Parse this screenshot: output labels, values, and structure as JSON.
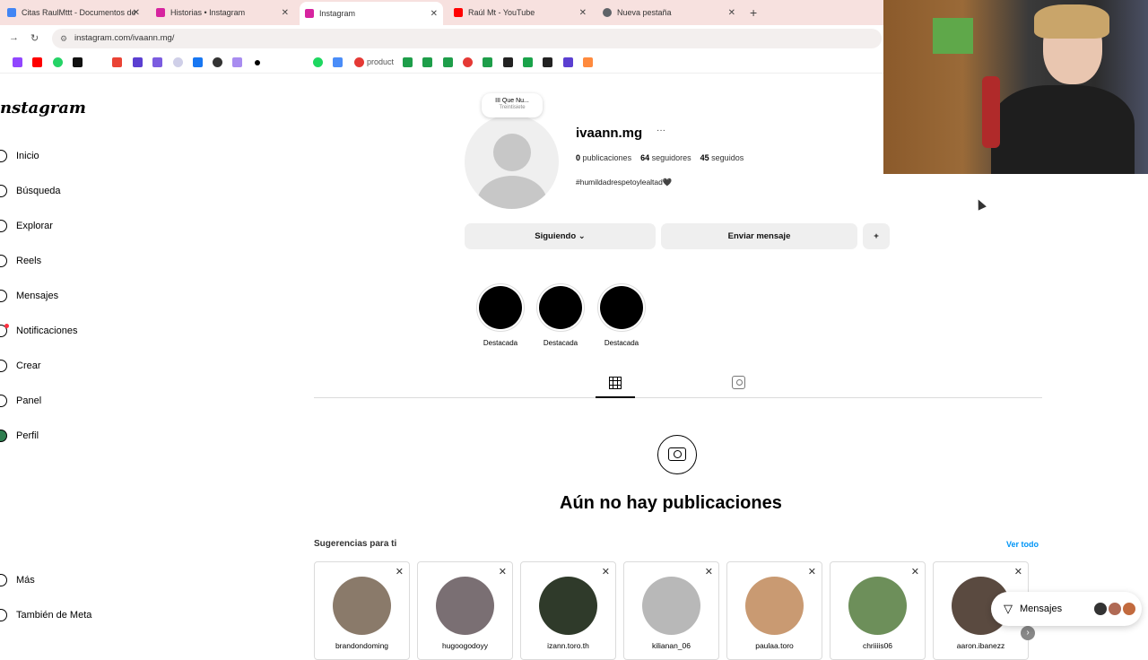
{
  "browser": {
    "tabs": [
      {
        "title": "Citas RaulMttt - Documentos de",
        "favicon_color": "#4285f4",
        "active": false
      },
      {
        "title": "Historias • Instagram",
        "favicon_color": "#d6249f",
        "active": false
      },
      {
        "title": "Instagram",
        "favicon_color": "#d6249f",
        "active": true
      },
      {
        "title": "Raúl Mt - YouTube",
        "favicon_color": "#ff0000",
        "active": false
      },
      {
        "title": "Nueva pestaña",
        "favicon_color": "#5f6368",
        "active": false
      }
    ],
    "close_glyph": "✕",
    "new_tab_glyph": "+",
    "url": "instagram.com/ivaann.mg/",
    "bookmark_text": "product"
  },
  "sidebar": {
    "logo": "nstagram",
    "items": [
      {
        "label": "Inicio"
      },
      {
        "label": "Búsqueda"
      },
      {
        "label": "Explorar"
      },
      {
        "label": "Reels"
      },
      {
        "label": "Mensajes"
      },
      {
        "label": "Notificaciones"
      },
      {
        "label": "Crear"
      },
      {
        "label": "Panel"
      },
      {
        "label": "Perfil"
      }
    ],
    "more": "Más",
    "meta": "También de Meta"
  },
  "profile": {
    "note_title": "III Que Nu...",
    "note_sub": "Treintisiete",
    "username": "ivaann.mg",
    "more_glyph": "···",
    "posts_count": "0",
    "posts_label": "publicaciones",
    "followers_count": "64",
    "followers_label": "seguidores",
    "following_count": "45",
    "following_label": "seguidos",
    "bio": "#humildadrespetoylealtad🖤",
    "following_button": "Siguiendo ⌄",
    "message_button": "Enviar mensaje",
    "add_person_glyph": "+"
  },
  "highlights": [
    {
      "label": "Destacada"
    },
    {
      "label": "Destacada"
    },
    {
      "label": "Destacada"
    }
  ],
  "empty_state": "Aún no hay publicaciones",
  "suggestions": {
    "title": "Sugerencias para ti",
    "see_all": "Ver todo",
    "cards": [
      {
        "name": "brandondoming",
        "color": "#8a7a6a"
      },
      {
        "name": "hugoogodoyy",
        "color": "#7a6f73"
      },
      {
        "name": "izann.toro.th",
        "color": "#2f3a2a"
      },
      {
        "name": "kilianan_06",
        "color": "#b8b8b8"
      },
      {
        "name": "paulaa.toro",
        "color": "#c99a72"
      },
      {
        "name": "chriiiis06",
        "color": "#6d8f5a"
      },
      {
        "name": "aaron.ibanezz",
        "color": "#5a4a40"
      }
    ],
    "close_glyph": "✕",
    "next_glyph": "›"
  },
  "messages_pill": {
    "label": "Mensajes"
  }
}
